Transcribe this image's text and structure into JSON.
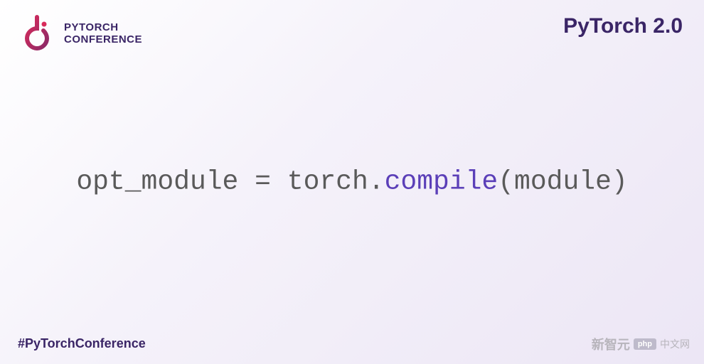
{
  "header": {
    "logo": {
      "line1": "PYTORCH",
      "line2": "CONFERENCE"
    },
    "title": "PyTorch 2.0"
  },
  "code": {
    "assign": "opt_module = torch.",
    "method": "compile",
    "args": "(module)"
  },
  "footer": {
    "hashtag": "#PyTorchConference"
  },
  "watermark": {
    "text1": "新智元",
    "badge": "php",
    "text2": "中文网"
  }
}
